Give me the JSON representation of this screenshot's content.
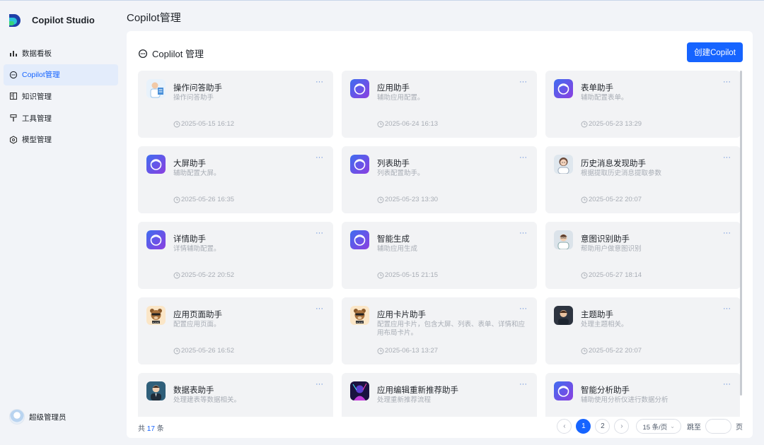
{
  "brand": {
    "name": "Copilot Studio"
  },
  "sidebar": {
    "items": [
      {
        "label": "数据看板",
        "icon": "bar-chart-icon",
        "active": false
      },
      {
        "label": "Copilot管理",
        "icon": "chat-bubble-icon",
        "active": true
      },
      {
        "label": "知识管理",
        "icon": "book-icon",
        "active": false
      },
      {
        "label": "工具管理",
        "icon": "hammer-icon",
        "active": false
      },
      {
        "label": "模型管理",
        "icon": "cube-icon",
        "active": false
      }
    ],
    "user": "超级管理员"
  },
  "header": {
    "title": "Copilot管理"
  },
  "panel": {
    "title": "Coplilot 管理",
    "create_label": "创建Copilot"
  },
  "cards": [
    {
      "name": "操作问答助手",
      "desc": "操作问答助手",
      "time": "2025-05-15 16:12",
      "avatar": "doctor-avatar"
    },
    {
      "name": "应用助手",
      "desc": "辅助应用配置。",
      "time": "2025-06-24 16:13",
      "avatar": "purple-orb-avatar"
    },
    {
      "name": "表单助手",
      "desc": "辅助配置表单。",
      "time": "2025-05-23 13:29",
      "avatar": "purple-orb-avatar"
    },
    {
      "name": "大屏助手",
      "desc": "辅助配置大屏。",
      "time": "2025-05-26 16:35",
      "avatar": "purple-orb-avatar"
    },
    {
      "name": "列表助手",
      "desc": "列表配置助手。",
      "time": "2025-05-23 13:30",
      "avatar": "purple-orb-avatar"
    },
    {
      "name": "历史消息发现助手",
      "desc": "根据提取历史消息提取参数",
      "time": "2025-05-22 20:07",
      "avatar": "girl-avatar"
    },
    {
      "name": "详情助手",
      "desc": "详情辅助配置。",
      "time": "2025-05-22 20:52",
      "avatar": "purple-orb-avatar"
    },
    {
      "name": "智能生成",
      "desc": "辅助应用生成",
      "time": "2025-05-15 21:15",
      "avatar": "purple-orb-avatar"
    },
    {
      "name": "意图识别助手",
      "desc": "帮助用户做意图识别",
      "time": "2025-05-27 18:14",
      "avatar": "man-avatar"
    },
    {
      "name": "应用页面助手",
      "desc": "配置应用页面。",
      "time": "2025-05-26 16:52",
      "avatar": "bear-agent-avatar"
    },
    {
      "name": "应用卡片助手",
      "desc": "配置应用卡片，包含大屏、列表、表单、详情和应用布局卡片。",
      "time": "2025-06-13 13:27",
      "avatar": "bear-agent-avatar"
    },
    {
      "name": "主题助手",
      "desc": "处理主题相关。",
      "time": "2025-05-22 20:07",
      "avatar": "dark-man-avatar"
    },
    {
      "name": "数据表助手",
      "desc": "处理建表等数据相关。",
      "time": "",
      "avatar": "suit-man-avatar"
    },
    {
      "name": "应用编辑重新推荐助手",
      "desc": "处理重新推荐流程",
      "time": "",
      "avatar": "neon-avatar"
    },
    {
      "name": "智能分析助手",
      "desc": "辅助使用分析仪进行数据分析",
      "time": "",
      "avatar": "purple-orb-avatar"
    }
  ],
  "footer": {
    "total_prefix": "共",
    "total_count": "17",
    "total_suffix": "条",
    "pages": [
      "1",
      "2"
    ],
    "current_page": "1",
    "page_size": "15 条/页",
    "jump_label": "跳至",
    "page_unit": "页"
  },
  "colors": {
    "accent": "#1664ff",
    "card_bg": "#f2f3f5",
    "muted": "#a8adb5"
  }
}
